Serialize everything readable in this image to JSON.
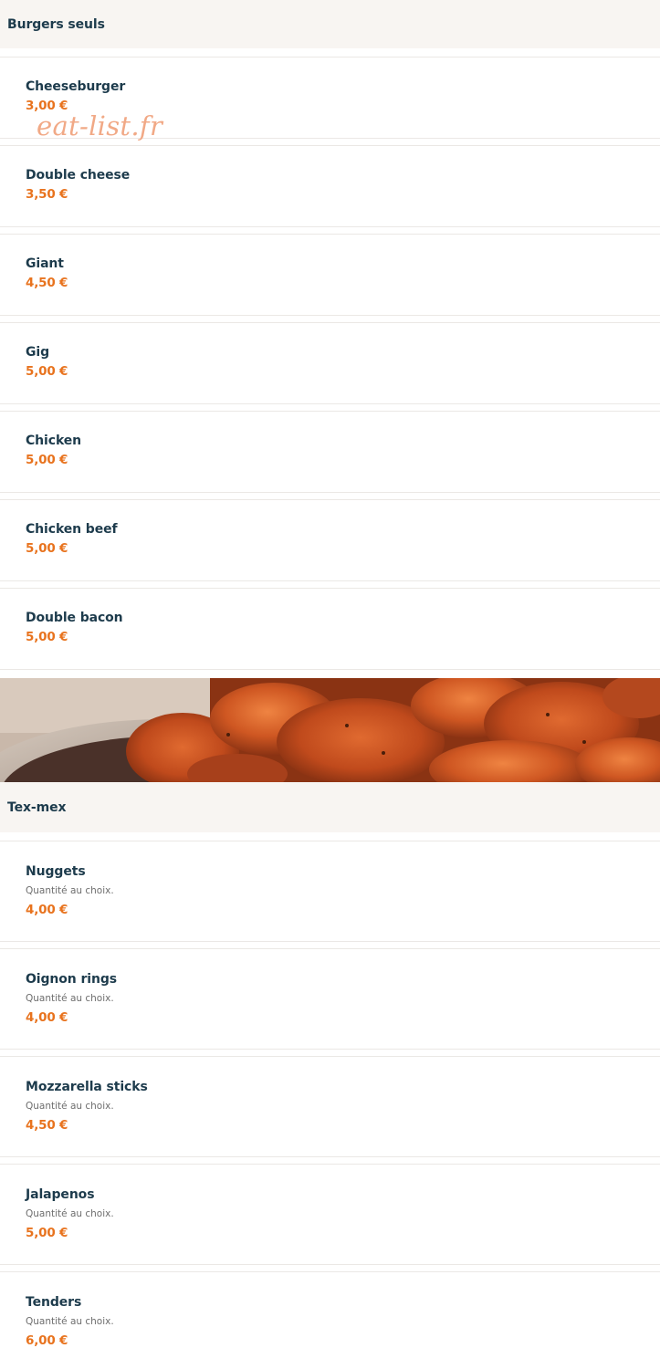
{
  "watermark": "eat-list.fr",
  "sections": [
    {
      "title": "Burgers seuls",
      "items": [
        {
          "name": "Cheeseburger",
          "price": "3,00 €"
        },
        {
          "name": "Double cheese",
          "price": "3,50 €"
        },
        {
          "name": "Giant",
          "price": "4,50 €"
        },
        {
          "name": "Gig",
          "price": "5,00 €"
        },
        {
          "name": "Chicken",
          "price": "5,00 €"
        },
        {
          "name": "Chicken beef",
          "price": "5,00 €"
        },
        {
          "name": "Double bacon",
          "price": "5,00 €"
        }
      ]
    },
    {
      "title": "Tex-mex",
      "image": "chicken-wings-photo",
      "items": [
        {
          "name": "Nuggets",
          "description": "Quantité au choix.",
          "price": "4,00 €"
        },
        {
          "name": "Oignon rings",
          "description": "Quantité au choix.",
          "price": "4,00 €"
        },
        {
          "name": "Mozzarella sticks",
          "description": "Quantité au choix.",
          "price": "4,50 €"
        },
        {
          "name": "Jalapenos",
          "description": "Quantité au choix.",
          "price": "5,00 €"
        },
        {
          "name": "Tenders",
          "description": "Quantité au choix.",
          "price": "6,00 €"
        }
      ]
    }
  ],
  "colors": {
    "header_bg": "#f8f5f2",
    "title": "#1d3b4c",
    "price": "#e8731e",
    "description": "#6e6e6e",
    "watermark": "#f0a07a"
  }
}
